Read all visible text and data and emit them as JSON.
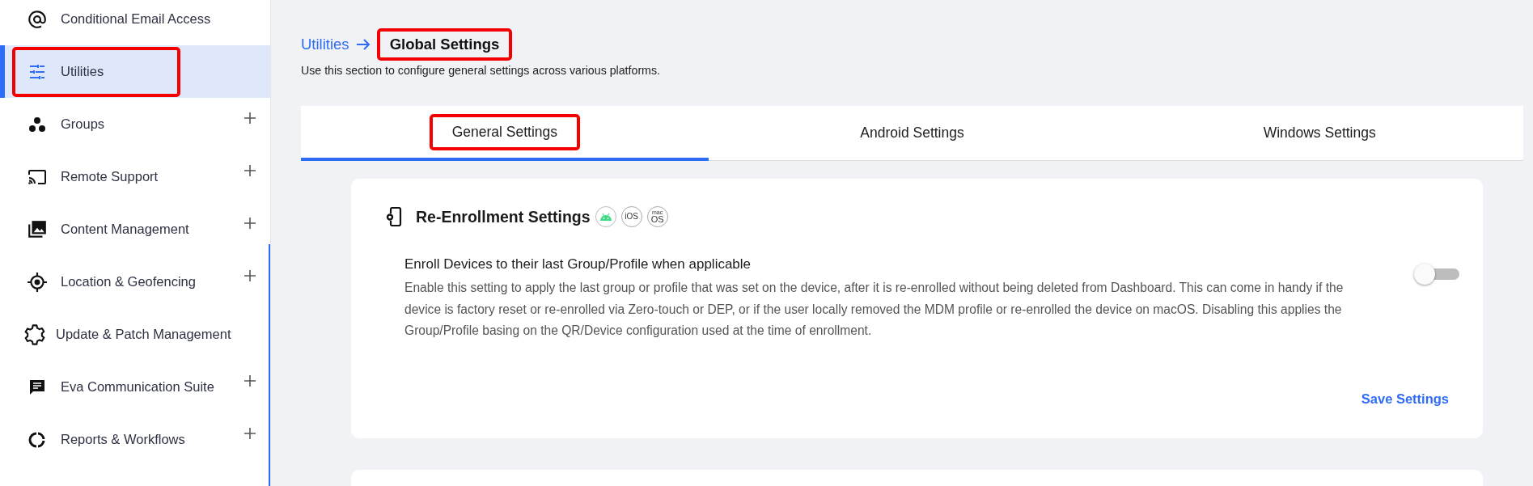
{
  "sidebar": {
    "items": [
      {
        "label": "Conditional Email Access",
        "selected": false,
        "expandable": false,
        "highlighted": false
      },
      {
        "label": "Utilities",
        "selected": true,
        "expandable": false,
        "highlighted": true
      },
      {
        "label": "Groups",
        "selected": false,
        "expandable": true,
        "highlighted": false
      },
      {
        "label": "Remote Support",
        "selected": false,
        "expandable": true,
        "highlighted": false
      },
      {
        "label": "Content Management",
        "selected": false,
        "expandable": true,
        "highlighted": false
      },
      {
        "label": "Location & Geofencing",
        "selected": false,
        "expandable": true,
        "highlighted": false
      },
      {
        "label": "Update & Patch Management",
        "selected": false,
        "expandable": false,
        "highlighted": false
      },
      {
        "label": "Eva Communication Suite",
        "selected": false,
        "expandable": true,
        "highlighted": false
      },
      {
        "label": "Reports & Workflows",
        "selected": false,
        "expandable": true,
        "highlighted": false
      }
    ]
  },
  "breadcrumb": {
    "parent": "Utilities",
    "current": "Global Settings",
    "current_highlighted": true
  },
  "description": "Use this section to configure general settings across various platforms.",
  "tabs": [
    {
      "label": "General Settings",
      "selected": true,
      "highlighted": true
    },
    {
      "label": "Android Settings",
      "selected": false,
      "highlighted": false
    },
    {
      "label": "Windows Settings",
      "selected": false,
      "highlighted": false
    }
  ],
  "card": {
    "title": "Re-Enrollment Settings",
    "platforms": [
      {
        "kind": "android"
      },
      {
        "kind": "ios",
        "label": "iOS"
      },
      {
        "kind": "macos",
        "label": "OS",
        "sublabel": "mac"
      }
    ],
    "setting": {
      "title": "Enroll Devices to their last Group/Profile when applicable",
      "description": "Enable this setting to apply the last group or profile that was set on the device, after it is re-enrolled without being deleted from Dashboard. This can come in handy if the device is factory reset or re-enrolled via Zero-touch or DEP, or if the user locally removed the MDM profile or re-enrolled the device on macOS. Disabling this applies the Group/Profile basing on the QR/Device configuration used at the time of enrollment.",
      "on": false
    },
    "save_button": "Save Settings"
  }
}
